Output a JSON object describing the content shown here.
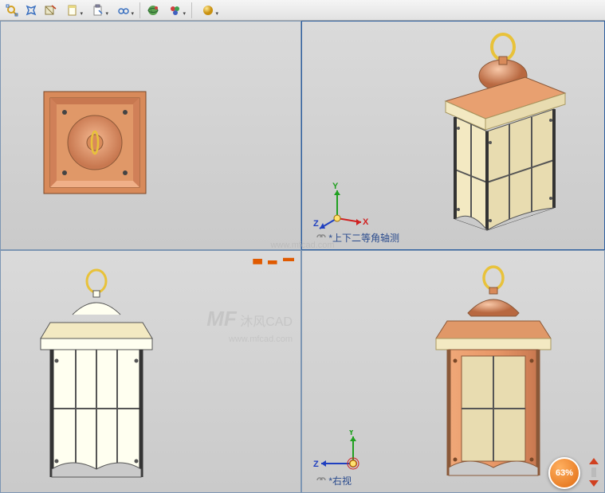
{
  "toolbar": {
    "items": [
      {
        "name": "zoom-fit-icon"
      },
      {
        "name": "zoom-window-icon"
      },
      {
        "name": "section-icon"
      },
      {
        "name": "page-icon",
        "dd": true
      },
      {
        "name": "clipboard-icon",
        "dd": true
      },
      {
        "name": "glasses-icon",
        "dd": true
      },
      {
        "name": "globe-appearance-icon"
      },
      {
        "name": "palette-icon",
        "dd": true
      },
      {
        "name": "gold-ball-icon",
        "dd": true
      }
    ]
  },
  "viewports": {
    "top_left": {
      "label": ""
    },
    "top_right": {
      "label": "*上下二等角轴测",
      "triad": {
        "x": "X",
        "y": "Y",
        "z": "Z"
      }
    },
    "bottom_left": {
      "label": ""
    },
    "bottom_right": {
      "label": "*右视",
      "triad": {
        "y": "Y",
        "z": "Z"
      }
    }
  },
  "watermarks": {
    "small": "www.mfcad.com",
    "big_brand": "沐风CAD",
    "big_sub": "www.mfcad.com"
  },
  "progress": {
    "value": "63%"
  },
  "colors": {
    "copper": "#d88a5a",
    "copper_dark": "#b06838",
    "cream": "#f3e9c2",
    "gold": "#e8c23a",
    "frame": "#555"
  }
}
